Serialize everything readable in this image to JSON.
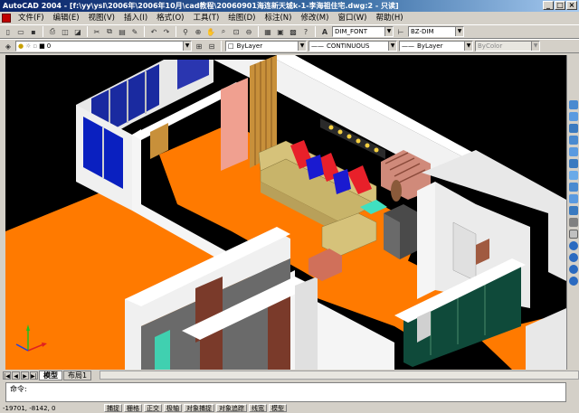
{
  "window": {
    "title": "AutoCAD 2004 - [f:\\yy\\ysl\\2006年\\2006年10月\\cad教程\\20060901海连新天城k-1-李海祖住宅.dwg:2 - 只读]"
  },
  "menu": [
    "文件(F)",
    "编辑(E)",
    "视图(V)",
    "插入(I)",
    "格式(O)",
    "工具(T)",
    "绘图(D)",
    "标注(N)",
    "修改(M)",
    "窗口(W)",
    "帮助(H)"
  ],
  "toolbar": {
    "text_style": "DIM_FONT",
    "dim_style": "BZ-DIM"
  },
  "properties": {
    "layer": "0",
    "color": "ByLayer",
    "linetype": "CONTINUOUS",
    "lineweight": "ByLayer",
    "plotstyle": "ByColor"
  },
  "tabs": {
    "model": "模型",
    "layout1": "布局1"
  },
  "command": {
    "prompt": "命令:"
  },
  "status": {
    "coords": "-19701, -8142, 0",
    "buttons": [
      "捕捉",
      "栅格",
      "正交",
      "极轴",
      "对象捕捉",
      "对象追踪",
      "线宽",
      "模型"
    ]
  },
  "colors": {
    "floor": "#ff7a00",
    "wall": "#f0f0f0",
    "sofa": "#d6c27a",
    "cushion_red": "#e8202a",
    "cushion_blue": "#1a1ad0",
    "glass_green": "#0f4a3a"
  }
}
